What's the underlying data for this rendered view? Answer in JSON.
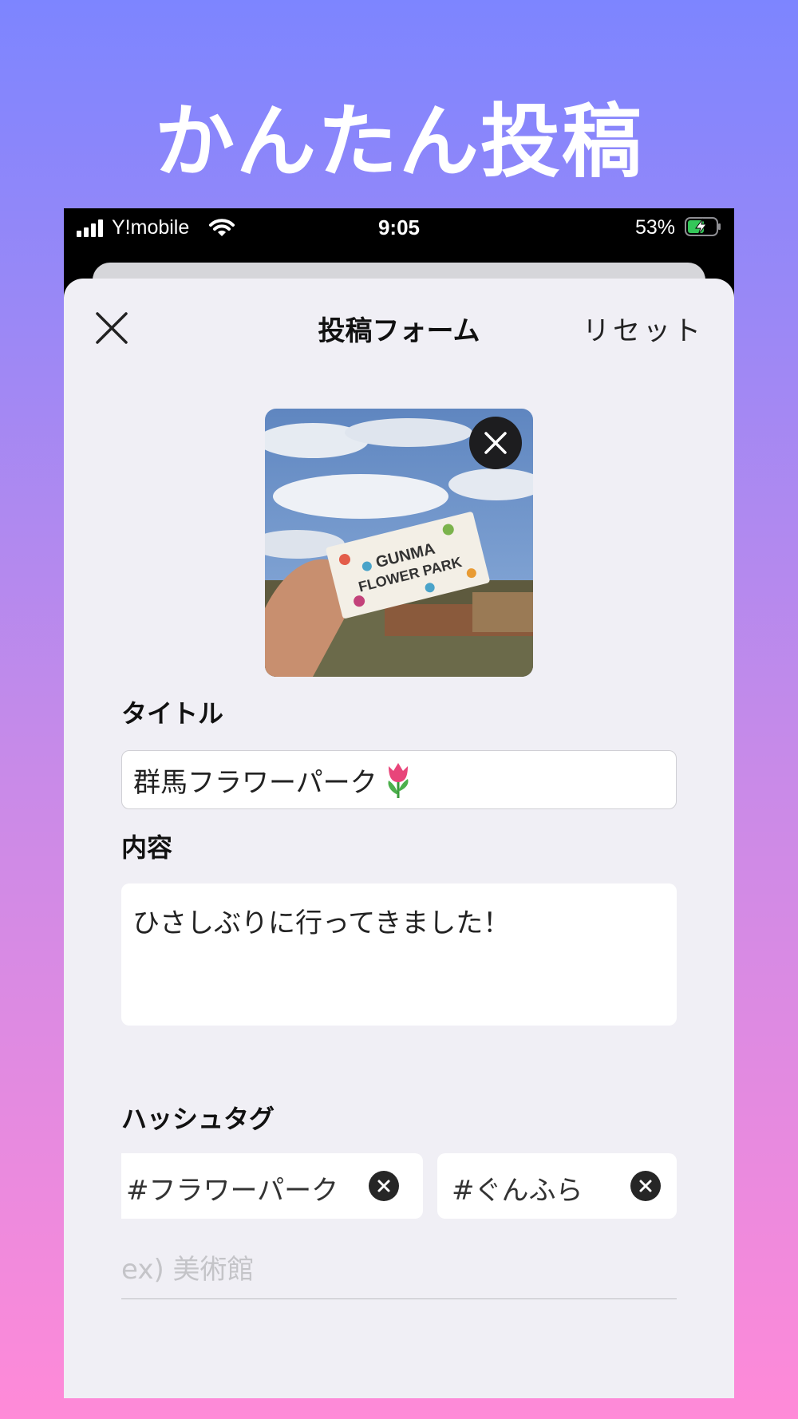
{
  "hero": {
    "title": "かんたん投稿"
  },
  "status_bar": {
    "carrier": "Y!mobile",
    "time": "9:05",
    "battery_percent": "53%"
  },
  "form": {
    "title": "投稿フォーム",
    "reset_label": "リセット",
    "title_label": "タイトル",
    "title_value": "群馬フラワーパーク",
    "content_label": "内容",
    "content_value": "ひさしぶりに行ってきました！",
    "hashtag_label": "ハッシュタグ",
    "hashtags": [
      "#フラワーパーク",
      "#ぐんふら"
    ],
    "hashtag_placeholder": "ex) 美術館",
    "photo_text": [
      "GUNMA",
      "FLOWER PARK"
    ]
  },
  "colors": {
    "gradient_top": "#7d85ff",
    "gradient_bottom": "#ff8ad8",
    "sheet_background": "#f0eff5",
    "battery_charge": "#34c759"
  },
  "icons": [
    "close-icon",
    "remove-photo-icon",
    "tulip-emoji-icon",
    "remove-tag-icon",
    "wifi-icon",
    "signal-icon",
    "battery-charging-icon"
  ]
}
